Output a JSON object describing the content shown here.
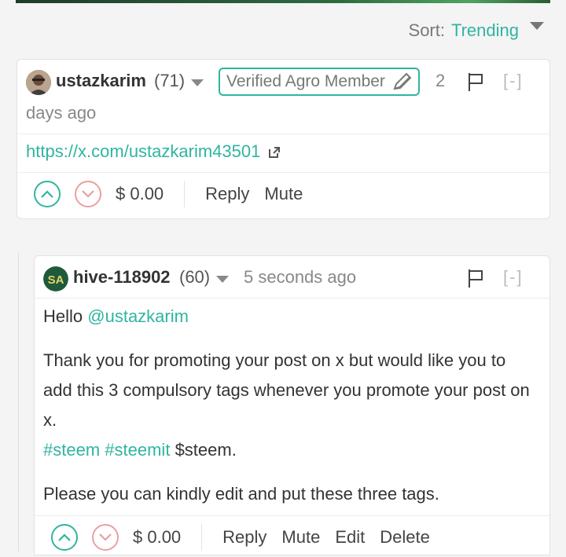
{
  "sort": {
    "label": "Sort:",
    "value": "Trending"
  },
  "comments": [
    {
      "author": "ustazkarim",
      "reputation": "(71)",
      "badge": "Verified Agro Member",
      "time_part1": "2",
      "time_part2": "days ago",
      "link": "https://x.com/ustazkarim43501",
      "collapse": "[-]",
      "payout": "$ 0.00",
      "actions": {
        "reply": "Reply",
        "mute": "Mute"
      }
    },
    {
      "author": "hive-118902",
      "reputation": "(60)",
      "time": "5 seconds ago",
      "collapse": "[-]",
      "body": {
        "greeting": "Hello",
        "mention": "@ustazkarim",
        "paragraph": "Thank you for promoting your post on x but would like you to add this 3 compulsory tags whenever you promote your post on x.",
        "tag1": "#steem",
        "tag2": "#steemit",
        "tag3": "$steem.",
        "closing": "Please you can kindly edit and put these three tags."
      },
      "payout": "$ 0.00",
      "actions": {
        "reply": "Reply",
        "mute": "Mute",
        "edit": "Edit",
        "delete": "Delete"
      }
    }
  ],
  "colors": {
    "accent": "#2fb5a0",
    "downvote": "#e8a0a0"
  }
}
